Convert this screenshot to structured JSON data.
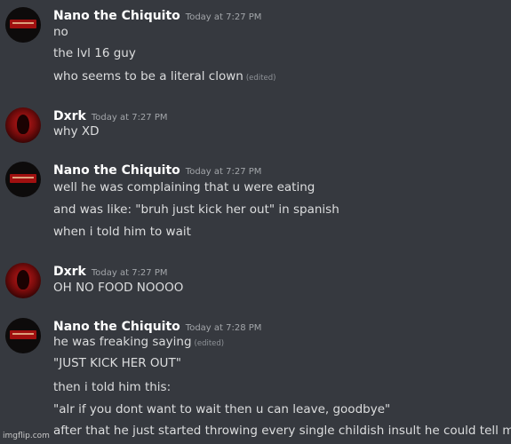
{
  "messages": [
    {
      "user": "Nano the Chiquito",
      "time": "Today at 7:27 PM",
      "lines": [
        "no",
        "the lvl 16 guy",
        "who seems to be a literal clown"
      ],
      "edited_label": "(edited)"
    },
    {
      "user": "Dxrk",
      "time": "Today at 7:27 PM",
      "lines": [
        "why XD"
      ]
    },
    {
      "user": "Nano the Chiquito",
      "time": "Today at 7:27 PM",
      "lines": [
        "well he was complaining that u were eating",
        "and was like: \"bruh just kick her out\" in spanish",
        "when i told him to wait"
      ]
    },
    {
      "user": "Dxrk",
      "time": "Today at 7:27 PM",
      "lines": [
        "OH NO FOOD NOOOO"
      ]
    },
    {
      "user": "Nano the Chiquito",
      "time": "Today at 7:28 PM",
      "lines": [
        "he was freaking saying",
        "\"JUST KICK HER OUT\"",
        "then i told him this:",
        "\"alr if you dont want to wait then u can leave, goodbye\"",
        "after that he just started throwing every single childish insult he could tell me"
      ],
      "edited_label": "(edited)"
    }
  ],
  "watermark": "imgflip.com",
  "colors": {
    "background": "#36393f",
    "username": "#ffffff",
    "message_text": "#dcddde",
    "timestamp": "#a3a6aa"
  }
}
